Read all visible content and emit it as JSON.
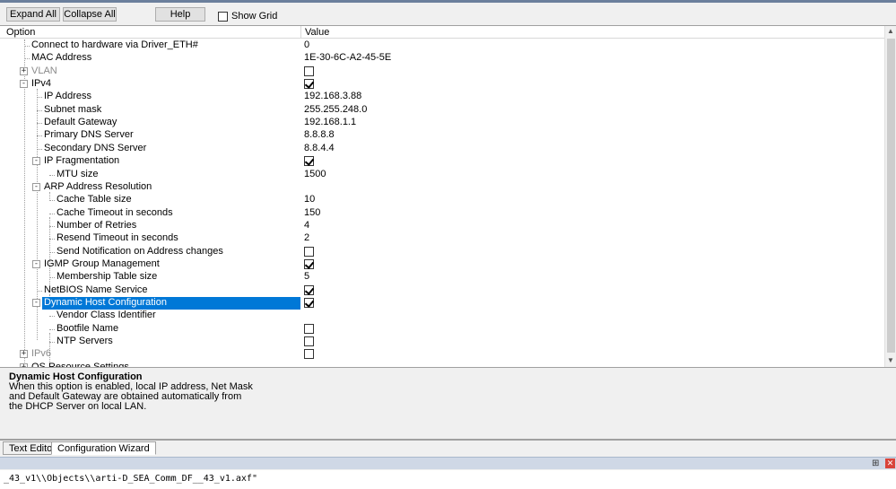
{
  "toolbar": {
    "expand_all": "Expand All",
    "collapse_all": "Collapse All",
    "help": "Help",
    "show_grid": "Show Grid"
  },
  "grid": {
    "col_option": "Option",
    "col_value": "Value",
    "rows": [
      {
        "name": "Connect to hardware via Driver_ETH#",
        "value": "0"
      },
      {
        "name": "MAC Address",
        "value": "1E-30-6C-A2-45-5E"
      },
      {
        "name": "VLAN",
        "checked": false
      },
      {
        "name": "IPv4",
        "checked": true
      },
      {
        "name": "IP Address",
        "value": "192.168.3.88"
      },
      {
        "name": "Subnet mask",
        "value": "255.255.248.0"
      },
      {
        "name": "Default Gateway",
        "value": "192.168.1.1"
      },
      {
        "name": "Primary DNS Server",
        "value": "8.8.8.8"
      },
      {
        "name": "Secondary DNS Server",
        "value": "8.8.4.4"
      },
      {
        "name": "IP Fragmentation",
        "checked": true
      },
      {
        "name": "MTU size",
        "value": "1500"
      },
      {
        "name": "ARP Address Resolution",
        "value": ""
      },
      {
        "name": "Cache Table size",
        "value": "10"
      },
      {
        "name": "Cache Timeout in seconds",
        "value": "150"
      },
      {
        "name": "Number of Retries",
        "value": "4"
      },
      {
        "name": "Resend Timeout in seconds",
        "value": "2"
      },
      {
        "name": "Send Notification on Address changes",
        "checked": false
      },
      {
        "name": "IGMP Group Management",
        "checked": true
      },
      {
        "name": "Membership Table size",
        "value": "5"
      },
      {
        "name": "NetBIOS Name Service",
        "checked": true
      },
      {
        "name": "Dynamic Host Configuration",
        "checked": true
      },
      {
        "name": "Vendor Class Identifier",
        "value": ""
      },
      {
        "name": "Bootfile Name",
        "checked": false
      },
      {
        "name": "NTP Servers",
        "checked": false
      },
      {
        "name": "IPv6",
        "checked": false
      },
      {
        "name": "OS Resource Settings",
        "value": ""
      }
    ]
  },
  "description": {
    "title": "Dynamic Host Configuration",
    "text": "When this option is enabled, local IP address, Net Mask\nand Default Gateway are obtained automatically from\nthe DHCP Server on local LAN."
  },
  "tabs": {
    "text_editor": "Text Editor",
    "config_wizard": "Configuration Wizard"
  },
  "output": {
    "line": "_43_v1\\\\Objects\\\\arti-D_SEA_Comm_DF__43_v1.axf\""
  }
}
